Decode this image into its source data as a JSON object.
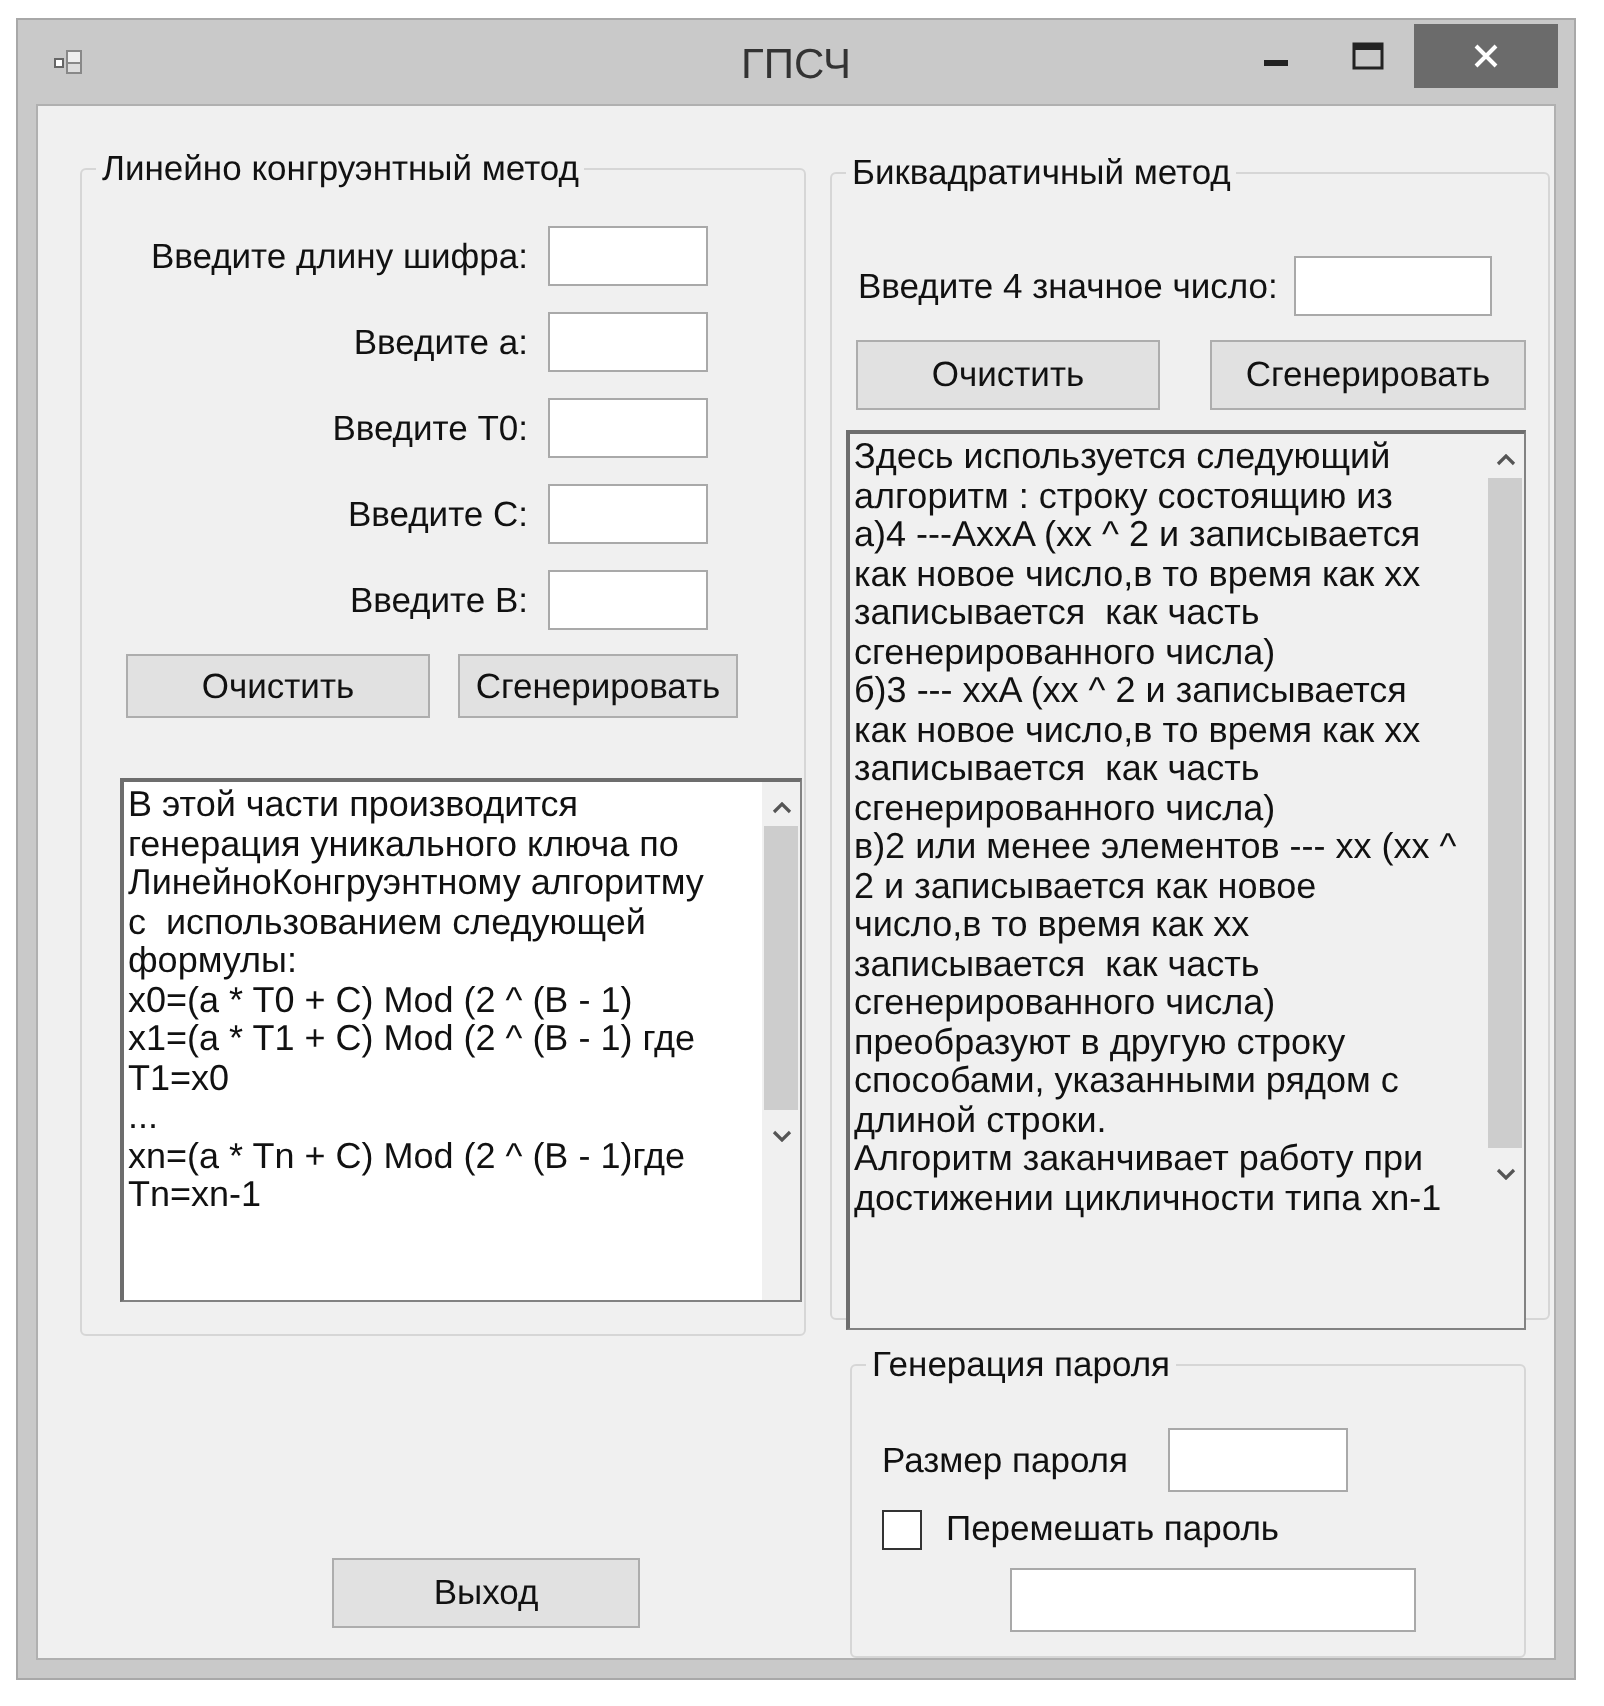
{
  "window": {
    "title": "ГПСЧ"
  },
  "lcg": {
    "title": "Линейно конгруэнтный метод",
    "fields": [
      {
        "label": "Введите длину шифра:"
      },
      {
        "label": "Введите а:"
      },
      {
        "label": "Введите Т0:"
      },
      {
        "label": "Введите С:"
      },
      {
        "label": "Введите В:"
      }
    ],
    "buttons": [
      "Очистить",
      "Сгенерировать"
    ],
    "output": {
      "readonly": false,
      "lines": [
        "В этой части производится",
        "генерация уникального ключа по",
        "ЛинейноКонгруэнтному алгоритму",
        "с  использованием следующей",
        "формулы:",
        "x0=(a * T0 + C) Mod (2 ^ (B - 1)",
        "x1=(a * T1 + C) Mod (2 ^ (B - 1) где",
        "T1=x0",
        "...",
        "xn=(a * Tn + C) Mod (2 ^ (B - 1)где",
        "Tn=xn-1"
      ]
    }
  },
  "bq": {
    "title": "Биквадратичный метод",
    "field": {
      "label": "Введите 4 значное число:"
    },
    "buttons": [
      "Очистить",
      "Сгенерировать"
    ],
    "output": {
      "readonly": true,
      "lines": [
        "Здесь используется следующий",
        "алгоритм : строку состоящию из",
        "а)4 ---AxxA (xx ^ 2 и записывается",
        "как новое число,в то время как xx",
        "записывается  как часть",
        "сгенерированного числа)",
        "б)3 --- xxA (xx ^ 2 и записывается",
        "как новое число,в то время как xx",
        "записывается  как часть",
        "сгенерированного числа)",
        "в)2 или менее элементов --- xx (xx ^",
        "2 и записывается как новое",
        "число,в то время как xx",
        "записывается  как часть",
        "сгенерированного числа)",
        "преобразуют в другую строку",
        "способами, указанными рядом с",
        "длиной строки.",
        "Алгоритм заканчивает работу при",
        "достижении цикличности типа xn-1"
      ]
    }
  },
  "password": {
    "title": "Генерация пароля",
    "size_label": "Размер пароля",
    "shuffle": {
      "label": "Перемешать пароль",
      "checked": false
    }
  },
  "exit_button": "Выход"
}
